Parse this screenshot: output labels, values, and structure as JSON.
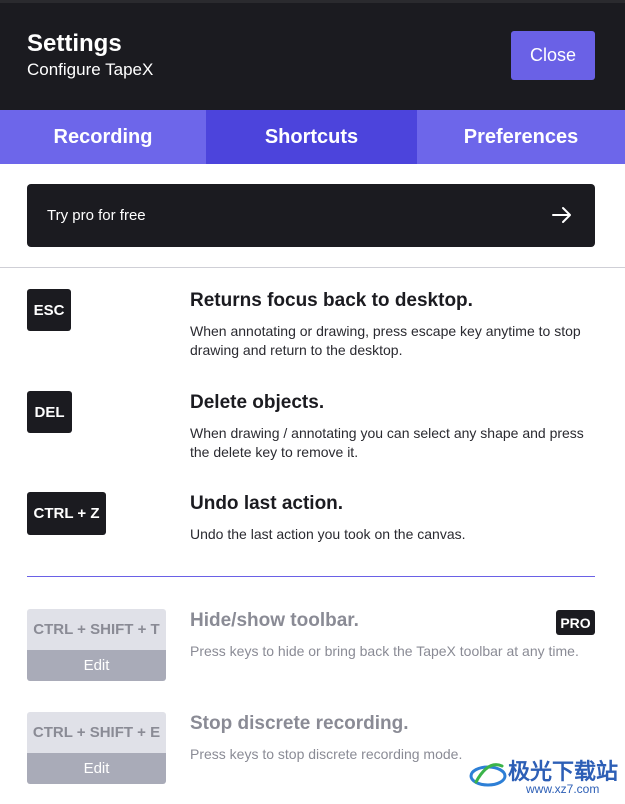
{
  "header": {
    "title": "Settings",
    "subtitle": "Configure TapeX",
    "close_label": "Close"
  },
  "tabs": [
    {
      "label": "Recording",
      "active": false
    },
    {
      "label": "Shortcuts",
      "active": true
    },
    {
      "label": "Preferences",
      "active": false
    }
  ],
  "promo": {
    "label": "Try pro for free",
    "icon": "arrow-right-icon"
  },
  "shortcuts": [
    {
      "key": "ESC",
      "title": "Returns focus back to desktop.",
      "description": "When annotating or drawing, press escape key anytime to stop drawing and return to the desktop."
    },
    {
      "key": "DEL",
      "title": "Delete objects.",
      "description": "When drawing / annotating you can select any shape and press the delete key to remove it."
    },
    {
      "key": "CTRL + Z",
      "title": "Undo last action.",
      "description": "Undo the last action you took on the canvas."
    }
  ],
  "pro_shortcuts": [
    {
      "key": "CTRL + SHIFT + T",
      "edit_label": "Edit",
      "title": "Hide/show toolbar.",
      "description": "Press keys to hide or bring back the TapeX toolbar at any time."
    },
    {
      "key": "CTRL + SHIFT + E",
      "edit_label": "Edit",
      "title": "Stop discrete recording.",
      "description": "Press keys to stop discrete recording mode."
    }
  ],
  "pro_badge": "PRO",
  "watermark": {
    "text": "极光下载站",
    "url": "www.xz7.com"
  },
  "colors": {
    "accent": "#6a61e6",
    "tab_active": "#4c44dc",
    "dark": "#1b1b20"
  }
}
